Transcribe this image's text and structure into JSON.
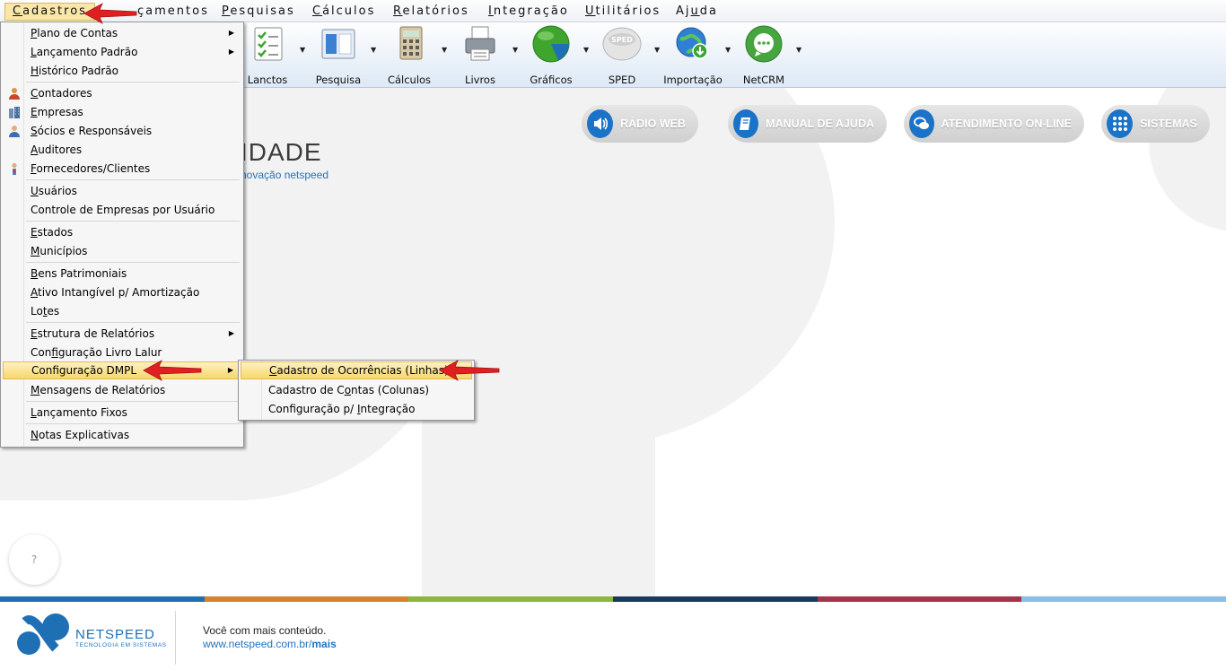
{
  "menubar": [
    {
      "accel": "C",
      "rest": "adastros"
    },
    {
      "accel": "",
      "rest": "çamentos"
    },
    {
      "accel": "P",
      "rest": "esquisas"
    },
    {
      "accel": "C",
      "rest": "álculos"
    },
    {
      "accel": "R",
      "rest": "elatórios"
    },
    {
      "accel": "I",
      "rest": "ntegração"
    },
    {
      "accel": "U",
      "rest": "tilitários"
    },
    {
      "accel": "",
      "rest": "Aj",
      "accel2": "u",
      "rest2": "da"
    }
  ],
  "toolbar": {
    "lanctos": "Lanctos",
    "pesquisa": "Pesquisa",
    "calculos": "Cálculos",
    "livros": "Livros",
    "graficos": "Gráficos",
    "sped": "SPED",
    "sped_icon_text": "SPED",
    "importacao": "Importação",
    "netcrm": "NetCRM"
  },
  "main": {
    "logo_text": "IDADE",
    "logo_sub": "novação netspeed",
    "help": "?",
    "pills": {
      "radio": "RÁDIO WEB",
      "manual": "MANUAL DE AJUDA",
      "atendimento": "ATENDIMENTO ON-LINE",
      "sistemas": "SISTEMAS"
    }
  },
  "menu_cadastros": {
    "items": [
      {
        "a": "P",
        "r": "lano de Contas"
      },
      {
        "a": "L",
        "r": "ançamento Padrão"
      },
      {
        "a": "H",
        "r": "istórico Padrão"
      },
      {
        "a": "C",
        "r": "ontadores"
      },
      {
        "a": "E",
        "r": "mpresas"
      },
      {
        "a": "S",
        "r": "ócios e Responsáveis"
      },
      {
        "a": "A",
        "r": "uditores"
      },
      {
        "a": "F",
        "r": "ornecedores/Clientes"
      },
      {
        "a": "U",
        "r": "suários"
      },
      {
        "a": "",
        "r": "Controle de Empresas por Usuário"
      },
      {
        "a": "E",
        "r": "stados"
      },
      {
        "a": "M",
        "r": "unicípios"
      },
      {
        "a": "B",
        "r": "ens Patrimoniais"
      },
      {
        "a": "A",
        "r": "tivo Intangível p/ Amortização"
      },
      {
        "p": "Lo",
        "a": "t",
        "r": "es"
      },
      {
        "a": "E",
        "r": "strutura de Relatórios"
      },
      {
        "p": "Con",
        "a": "f",
        "r": "iguração Livro Lalur"
      },
      {
        "a": "",
        "r": "Configuração DMPL"
      },
      {
        "a": "M",
        "r": "ensagens de Relatórios"
      },
      {
        "a": "L",
        "r": "ançamento Fixos"
      },
      {
        "a": "N",
        "r": "otas Explicativas"
      }
    ]
  },
  "menu_dmpl": {
    "items": [
      {
        "p": "",
        "a": "C",
        "r": "adastro de Ocorrências (Linhas)"
      },
      {
        "p": "Cadastro de C",
        "a": "o",
        "r": "ntas (Colunas)"
      },
      {
        "p": "Configuração p/ ",
        "a": "I",
        "r": "ntegração"
      }
    ]
  },
  "footer": {
    "brand": "NETSPEED",
    "tagline": "TECNOLOGIA EM SISTEMAS",
    "line1": "Você com mais conteúdo.",
    "line2_prefix": "www.netspeed.com.br/",
    "line2_bold": "mais"
  },
  "colors": {
    "strip": [
      "#1f6fb5",
      "#d9822b",
      "#8cb63c",
      "#1a3a5c",
      "#a8324a",
      "#8bbfe6"
    ],
    "accent": "#1b73c8",
    "arrow": "#e02020"
  }
}
